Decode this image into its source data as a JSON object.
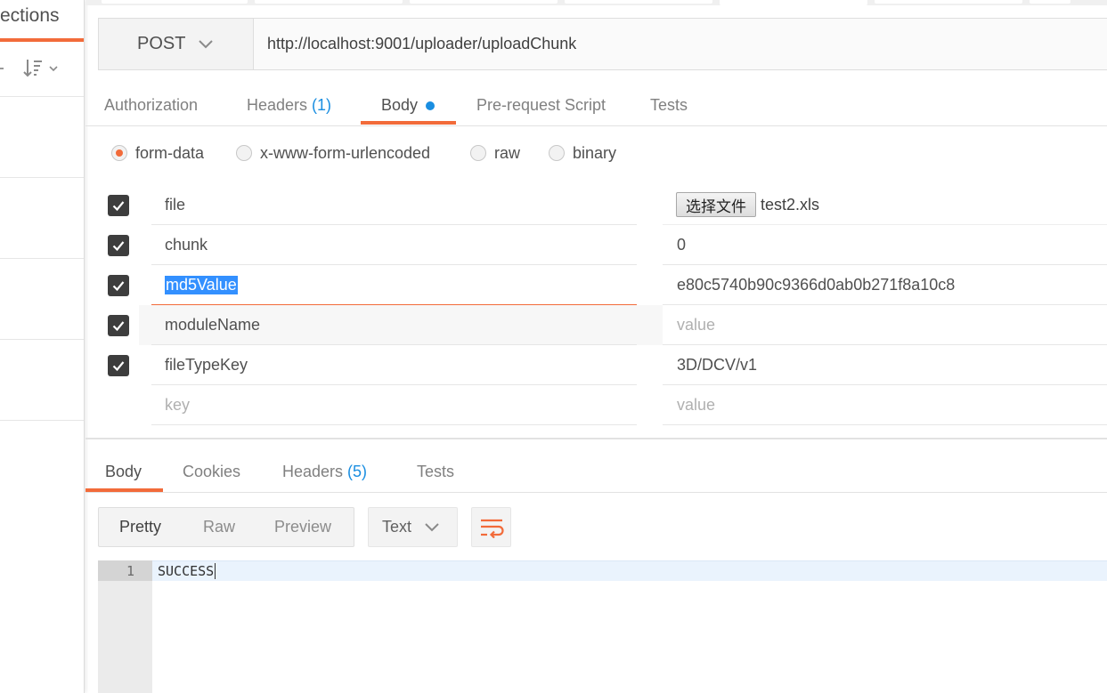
{
  "sidebar": {
    "title": "ections"
  },
  "request": {
    "method": "POST",
    "url": "http://localhost:9001/uploader/uploadChunk"
  },
  "request_tabs": [
    {
      "label": "Authorization"
    },
    {
      "label": "Headers",
      "count": "(1)"
    },
    {
      "label": "Body"
    },
    {
      "label": "Pre-request Script"
    },
    {
      "label": "Tests"
    }
  ],
  "body_types": [
    {
      "label": "form-data",
      "checked": true
    },
    {
      "label": "x-www-form-urlencoded",
      "checked": false
    },
    {
      "label": "raw",
      "checked": false
    },
    {
      "label": "binary",
      "checked": false
    }
  ],
  "form_rows": [
    {
      "key": "file",
      "file_button": "选择文件",
      "file_name": "test2.xls",
      "checked": true
    },
    {
      "key": "chunk",
      "value": "0",
      "checked": true
    },
    {
      "key": "md5Value",
      "value": "e80c5740b90c9366d0ab0b271f8a10c8",
      "checked": true
    },
    {
      "key": "moduleName",
      "value_placeholder": "value",
      "checked": true
    },
    {
      "key": "fileTypeKey",
      "value": "3D/DCV/v1",
      "checked": true
    },
    {
      "key_placeholder": "key",
      "value_placeholder": "value",
      "checked": false
    }
  ],
  "response_tabs": [
    {
      "label": "Body"
    },
    {
      "label": "Cookies"
    },
    {
      "label": "Headers",
      "count": "(5)"
    },
    {
      "label": "Tests"
    }
  ],
  "view_modes": [
    "Pretty",
    "Raw",
    "Preview"
  ],
  "format": "Text",
  "editor": {
    "line_number": "1",
    "content": "SUCCESS"
  },
  "colors": {
    "accent": "#f26b3a",
    "link_blue": "#1a8ee1",
    "selection": "#3390ff"
  }
}
